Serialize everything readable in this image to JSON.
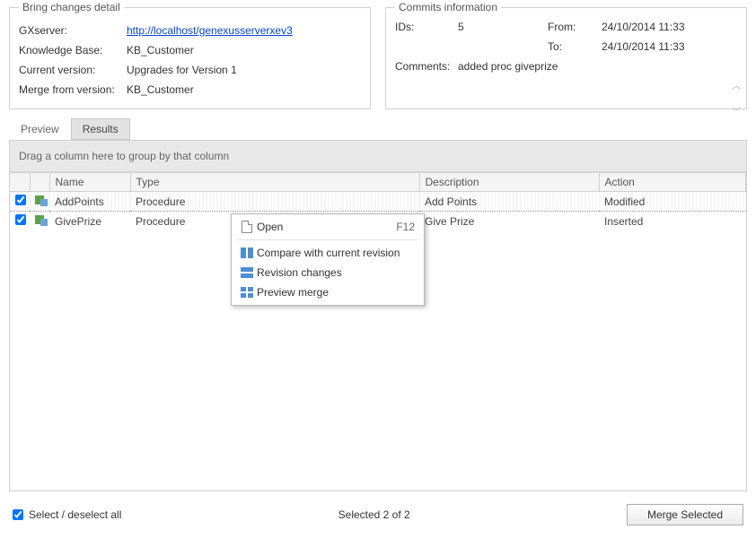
{
  "bring_changes": {
    "legend": "Bring changes detail",
    "gxserver_label": "GXserver:",
    "gxserver_url": "http://localhost/genexusserverxev3",
    "kb_label": "Knowledge Base:",
    "kb_value": "KB_Customer",
    "version_label": "Current version:",
    "version_value": "Upgrades for Version 1",
    "merge_from_label": "Merge from version:",
    "merge_from_value": "KB_Customer"
  },
  "commits_info": {
    "legend": "Commits information",
    "ids_label": "IDs:",
    "ids_value": "5",
    "from_label": "From:",
    "from_value": "24/10/2014 11:33",
    "to_label": "To:",
    "to_value": "24/10/2014 11:33",
    "comments_label": "Comments:",
    "comments_value": "added proc giveprize"
  },
  "tabs": {
    "preview": "Preview",
    "results": "Results"
  },
  "grid": {
    "group_hint": "Drag a column here to group by that column",
    "columns": {
      "name": "Name",
      "type": "Type",
      "description": "Description",
      "action": "Action"
    },
    "rows": [
      {
        "checked": true,
        "name": "AddPoints",
        "type": "Procedure",
        "description": "Add Points",
        "action": "Modified",
        "selected": true
      },
      {
        "checked": true,
        "name": "GivePrize",
        "type": "Procedure",
        "description": "Give Prize",
        "action": "Inserted",
        "selected": false
      }
    ]
  },
  "context_menu": {
    "open": "Open",
    "open_shortcut": "F12",
    "compare": "Compare with current revision",
    "revision": "Revision changes",
    "preview_merge": "Preview merge"
  },
  "footer": {
    "select_all": "Select / deselect all",
    "status": "Selected 2 of 2",
    "merge_button": "Merge Selected"
  }
}
